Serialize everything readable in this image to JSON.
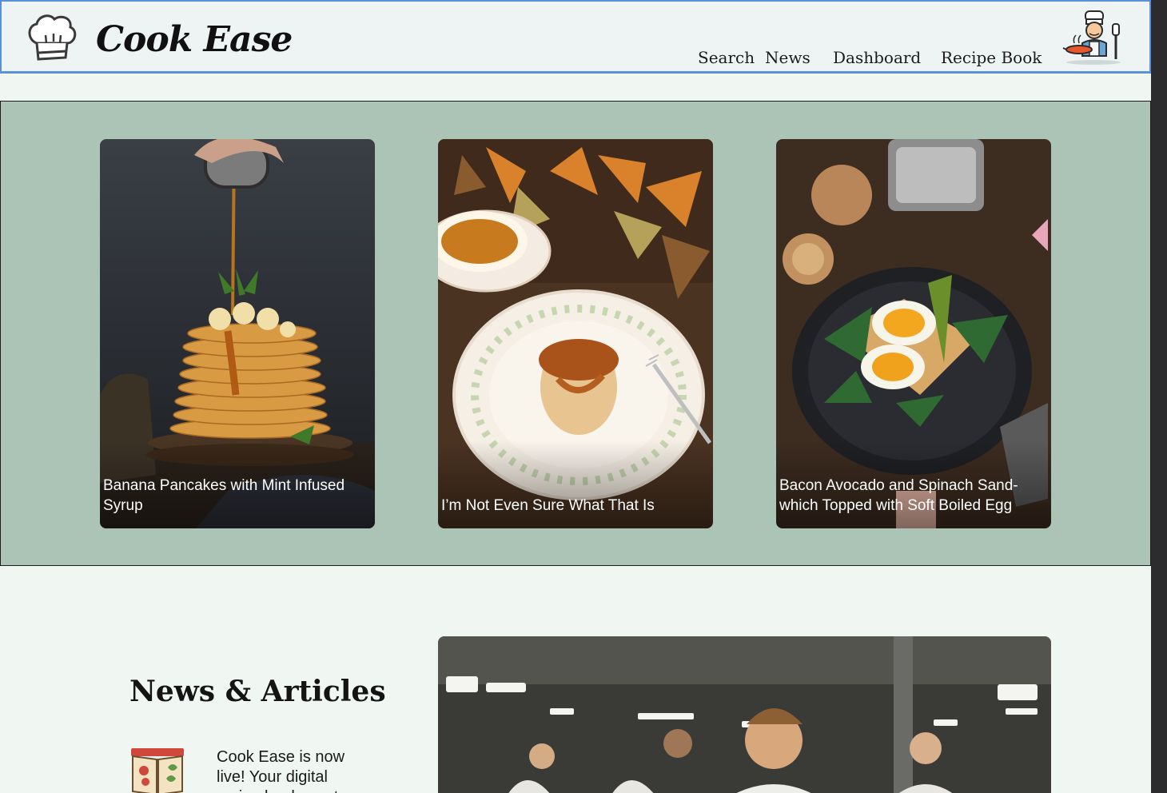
{
  "header": {
    "brand": "Cook Ease",
    "nav": [
      "Search",
      "News",
      "Dashboard",
      "Recipe Book"
    ]
  },
  "featured": {
    "cards": [
      {
        "caption": "Banana Pancakes with Mint Infused Syrup"
      },
      {
        "caption": "I’m Not Even Sure What That Is"
      },
      {
        "caption": "Bacon Avocado and Spinach Sand-which Topped with Soft Boiled Egg"
      }
    ]
  },
  "news": {
    "title": "News & Articles",
    "items": [
      {
        "text": "Cook Ease is now live! Your digital recipe book must..."
      }
    ]
  },
  "icons": {
    "logo": "chef-hat-icon",
    "avatar": "chef-cooking-icon",
    "news_item": "recipe-book-icon"
  },
  "colors": {
    "header_border": "#5b8fd6",
    "featured_bg": "#abc4b6",
    "page_bg": "#f0f7f3"
  }
}
